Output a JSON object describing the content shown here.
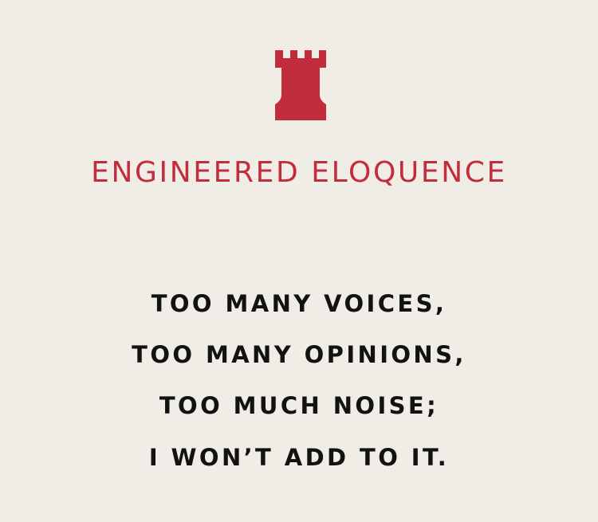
{
  "colors": {
    "background": "#f0ede6",
    "accent": "#c22d3c",
    "text": "#121212"
  },
  "logo": {
    "icon": "rook-icon"
  },
  "brand": {
    "name": "ENGINEERED ELOQUENCE"
  },
  "quote": {
    "lines": [
      "TOO MANY VOICES,",
      "TOO MANY OPINIONS,",
      "TOO MUCH NOISE;",
      "I WON’T ADD TO IT."
    ]
  }
}
